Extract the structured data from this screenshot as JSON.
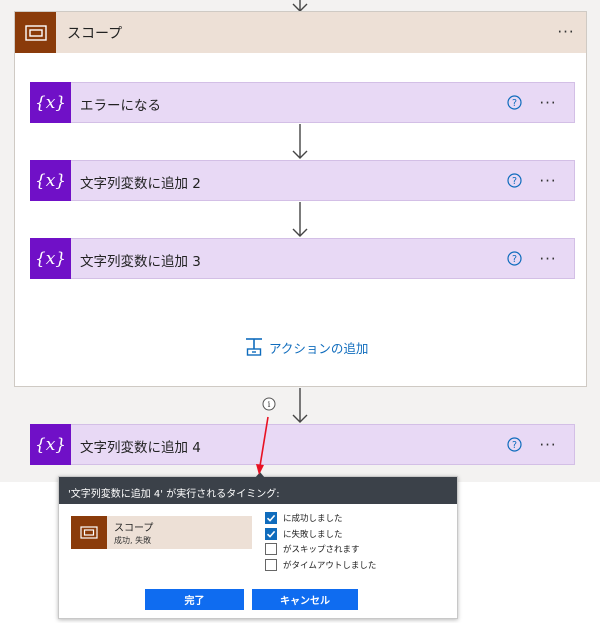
{
  "scope": {
    "title": "スコープ",
    "icon": "scope-icon",
    "more_label": "···",
    "actions": [
      {
        "label": "エラーになる",
        "icon": "variable-icon"
      },
      {
        "label": "文字列変数に追加 2",
        "icon": "variable-icon"
      },
      {
        "label": "文字列変数に追加 3",
        "icon": "variable-icon"
      }
    ],
    "add_action_label": "アクションの追加"
  },
  "next_action": {
    "label": "文字列変数に追加 4",
    "icon": "variable-icon"
  },
  "variable_glyph": "{x}",
  "run_after_popup": {
    "title": "'文字列変数に追加 4' が実行されるタイミング:",
    "card": {
      "title": "スコープ",
      "subtitle": "成功, 失敗"
    },
    "options": [
      {
        "label": "に成功しました",
        "checked": true
      },
      {
        "label": "に失敗しました",
        "checked": true
      },
      {
        "label": "がスキップされます",
        "checked": false
      },
      {
        "label": "がタイムアウトしました",
        "checked": false
      }
    ],
    "done_button": "完了",
    "cancel_button": "キャンセル"
  },
  "colors": {
    "scope_accent": "#8a3b0a",
    "scope_header_bg": "#ede0d6",
    "variable_accent": "#7010c7",
    "variable_card_bg": "#e8d9f5",
    "link_blue": "#0f6cbd",
    "pointer_red": "#e81123"
  }
}
